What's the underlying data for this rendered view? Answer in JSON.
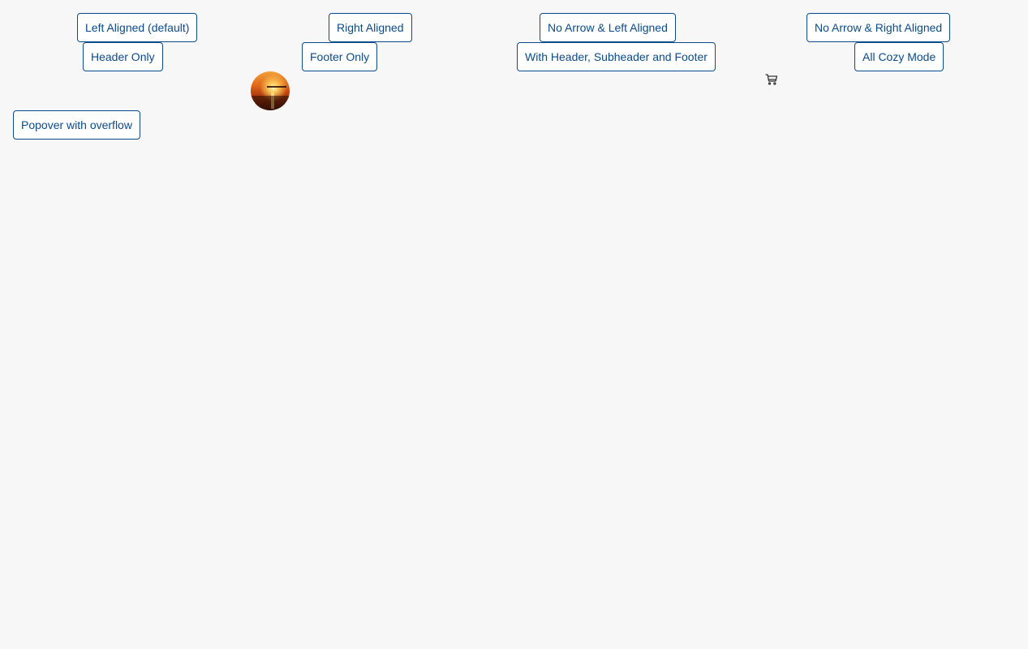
{
  "buttons": {
    "left_aligned": "Left Aligned (default)",
    "right_aligned": "Right Aligned",
    "no_arrow_left": "No Arrow & Left Aligned",
    "no_arrow_right": "No Arrow & Right Aligned",
    "header_only": "Header Only",
    "footer_only": "Footer Only",
    "header_subheader_footer": "With Header, Subheader and Footer",
    "all_cozy": "All Cozy Mode",
    "popover_overflow": "Popover with overflow"
  },
  "icons": {
    "avatar": "sunset-avatar-image",
    "cart": "cart-icon"
  },
  "colors": {
    "background": "#f7f7f7",
    "button_border": "#0a4a8a",
    "button_text": "#0a4a8a",
    "button_bg": "#ffffff"
  }
}
